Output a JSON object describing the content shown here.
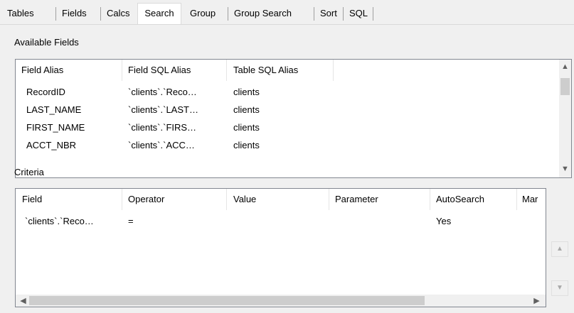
{
  "tabs": [
    {
      "label": "Tables"
    },
    {
      "label": "Fields"
    },
    {
      "label": "Calcs"
    },
    {
      "label": "Search"
    },
    {
      "label": "Group"
    },
    {
      "label": "Group Search"
    },
    {
      "label": "Sort"
    },
    {
      "label": "SQL"
    }
  ],
  "active_tab": "Search",
  "available_fields": {
    "label": "Available Fields",
    "columns": [
      "Field Alias",
      "Field SQL Alias",
      "Table SQL Alias"
    ],
    "rows": [
      [
        "RecordID",
        "`clients`.`Reco…",
        "clients"
      ],
      [
        "LAST_NAME",
        "`clients`.`LAST…",
        "clients"
      ],
      [
        "FIRST_NAME",
        "`clients`.`FIRS…",
        "clients"
      ],
      [
        "ACCT_NBR",
        "`clients`.`ACC…",
        "clients"
      ]
    ]
  },
  "criteria": {
    "label": "Criteria",
    "columns": [
      "Field",
      "Operator",
      "Value",
      "Parameter",
      "AutoSearch",
      "Mar"
    ],
    "rows": [
      [
        "`clients`.`Reco…",
        "=",
        "",
        "",
        "Yes",
        ""
      ]
    ]
  },
  "icons": {
    "scroll_up": "▲",
    "scroll_down": "▼",
    "scroll_left": "◀",
    "scroll_right": "▶",
    "move_up": "▲",
    "move_down": "▼"
  }
}
